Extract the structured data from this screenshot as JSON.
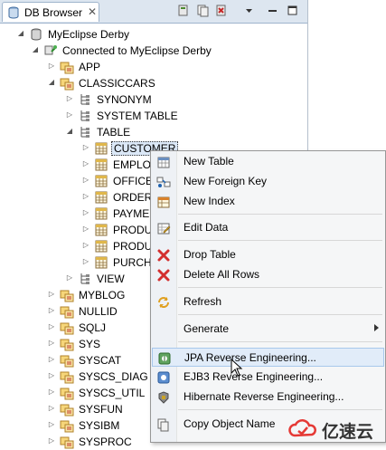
{
  "tab": {
    "title": "DB Browser",
    "close": "✕"
  },
  "tree": {
    "root": "MyEclipse Derby",
    "connection": "Connected to MyEclipse Derby",
    "schemas_top": [
      "APP",
      "CLASSICCARS"
    ],
    "classiccars_children": [
      "SYNONYM",
      "SYSTEM TABLE",
      "TABLE"
    ],
    "tables": [
      "CUSTOMER",
      "EMPLOY",
      "OFFICE",
      "ORDERD",
      "PAYMEN",
      "PRODUC",
      "PRODUC",
      "PURCHA"
    ],
    "view": "VIEW",
    "schemas_bottom": [
      "MYBLOG",
      "NULLID",
      "SQLJ",
      "SYS",
      "SYSCAT",
      "SYSCS_DIAG",
      "SYSCS_UTIL",
      "SYSFUN",
      "SYSIBM",
      "SYSPROC"
    ]
  },
  "menu": {
    "new_table": "New Table",
    "new_foreign_key": "New Foreign Key",
    "new_index": "New Index",
    "edit_data": "Edit Data",
    "drop_table": "Drop Table",
    "delete_all_rows": "Delete All Rows",
    "refresh": "Refresh",
    "generate": "Generate",
    "jpa": "JPA Reverse Engineering...",
    "ejb3": "EJB3 Reverse Engineering...",
    "hibernate": "Hibernate Reverse Engineering...",
    "copy_object_name": "Copy Object Name"
  },
  "watermark": "亿速云"
}
